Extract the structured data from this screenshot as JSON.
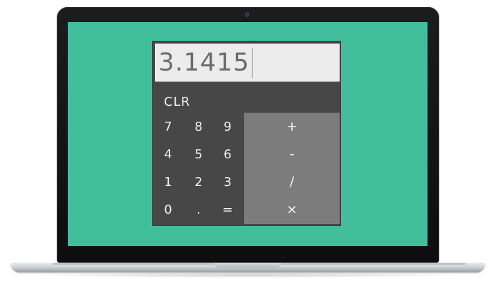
{
  "calculator": {
    "display_value": "3.1415",
    "clear_label": "CLR",
    "digit_keys": [
      [
        "7",
        "8",
        "9"
      ],
      [
        "4",
        "5",
        "6"
      ],
      [
        "1",
        "2",
        "3"
      ],
      [
        "0",
        ".",
        "="
      ]
    ],
    "operator_keys": [
      "+",
      "-",
      "/",
      "×"
    ]
  },
  "colors": {
    "screen_background": "#41bf9d",
    "calculator_body": "#474747",
    "operator_panel": "#7c7c7c",
    "display_background": "#ececec",
    "display_text": "#6a6a6a"
  }
}
